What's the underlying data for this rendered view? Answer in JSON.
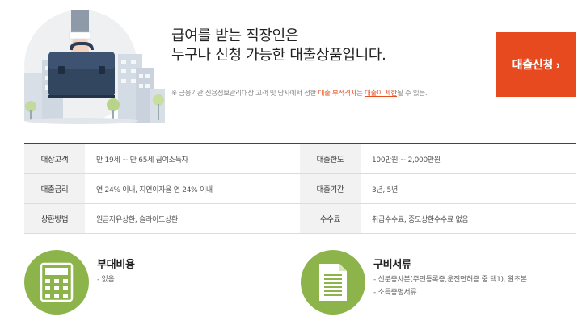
{
  "hero": {
    "headline_line1": "급여를 받는 직장인은",
    "headline_line2": "누구나 신청 가능한 대출상품입니다.",
    "notice_prefix": "※ 금융기관 신용정보관리대상 고객 및 당사에서 정한 ",
    "notice_red1": "대출 부적격자",
    "notice_mid": "는 ",
    "notice_red2": "대출이 제한",
    "notice_suffix": "될 수 있음.",
    "apply_label": "대출신청",
    "apply_chevron": "›",
    "accent_color": "#e84a1f"
  },
  "info": {
    "rows": [
      {
        "label1": "대상고객",
        "value1": "만 19세 ~ 만 65세 급여소득자",
        "label2": "대출한도",
        "value2": "100만원 ~ 2,000만원"
      },
      {
        "label1": "대출금리",
        "value1": "연 24% 이내, 지연이자율 연 24% 이내",
        "label2": "대출기간",
        "value2": "3년, 5년"
      },
      {
        "label1": "상환방법",
        "value1": "원금자유상환, 슬라이드상환",
        "label2": "수수료",
        "value2": "취급수수료, 중도상환수수료 없음"
      }
    ]
  },
  "features": {
    "cost": {
      "title": "부대비용",
      "lines": [
        "- 없음"
      ],
      "icon": "calculator-icon"
    },
    "docs": {
      "title": "구비서류",
      "lines": [
        "- 신분증사본(주민등록증,운전면허증 중 택1), 원초본",
        "- 소득증명서류"
      ],
      "icon": "document-icon"
    },
    "icon_color": "#8cb44b"
  }
}
